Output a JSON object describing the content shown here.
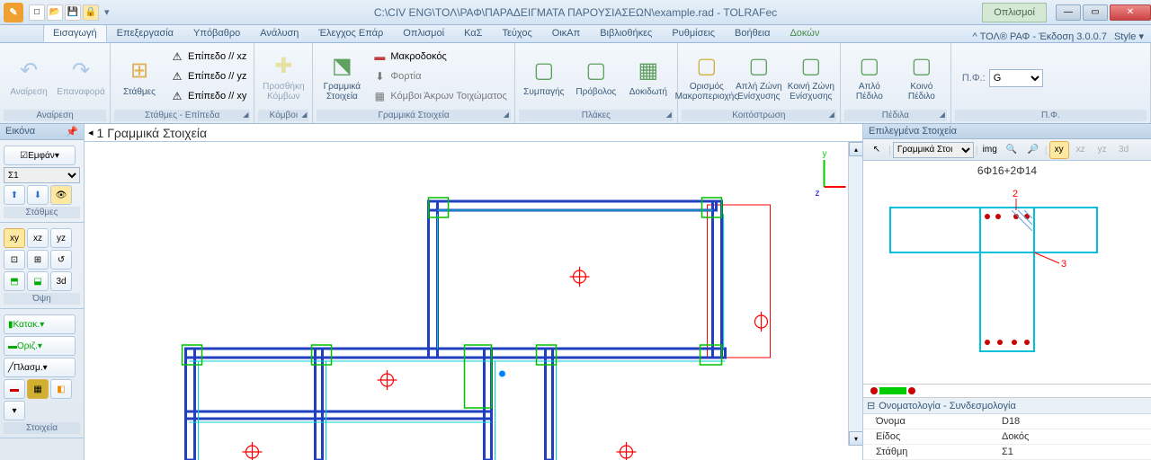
{
  "title": "C:\\CIV ENG\\ΤΟΛ\\ΡΑΦ\\ΠΑΡΑΔΕΙΓΜΑΤΑ ΠΑΡΟΥΣΙΑΣΕΩΝ\\example.rad - TOLRAFec",
  "context_tab": "Οπλισμοί",
  "version": "ΤΟΛ® ΡΑΦ - Έκδοση 3.0.0.7",
  "style_label": "Style",
  "tabs": [
    "Εισαγωγή",
    "Επεξεργασία",
    "Υπόβαθρο",
    "Ανάλυση",
    "Έλεγχος Επάρ",
    "Οπλισμοί",
    "ΚαΣ",
    "Τεύχος",
    "ΟικΑπ",
    "Βιβλιοθήκες",
    "Ρυθμίσεις",
    "Βοήθεια",
    "Δοκών"
  ],
  "ribbon": {
    "g1_title": "Αναίρεση",
    "g1_undo": "Αναίρεση",
    "g1_redo": "Επαναφορά",
    "g2_title": "Στάθμες - Επίπεδα",
    "g2_stathmes": "Στάθμες",
    "g2_xz": "Επίπεδο // xz",
    "g2_yz": "Επίπεδο // yz",
    "g2_xy": "Επίπεδο // xy",
    "g3_title": "Κόμβοι",
    "g3_node": "Προσθήκη\nΚόμβων",
    "g4_title": "Γραμμικά Στοιχεία",
    "g4_linear": "Γραμμικά\nΣτοιχεία",
    "g4_macro": "Μακροδοκός",
    "g4_load": "Φορτία",
    "g4_wall": "Κόμβοι Άκρων Τοιχώματος",
    "g5_title": "Πλάκες",
    "g5_solid": "Συμπαγής",
    "g5_cant": "Πρόβολος",
    "g5_holl": "Δοκιδωτή",
    "g6_title": "Κοιτόστρωση",
    "g6_macro": "Ορισμός\nΜακροπεριοχής",
    "g6_simple": "Απλή Ζώνη\nΕνίσχυσης",
    "g6_common": "Κοινή Ζώνη\nΕνίσχυσης",
    "g7_title": "Πέδιλα",
    "g7_simple": "Απλό\nΠέδιλο",
    "g7_common": "Κοινό\nΠέδιλο",
    "g8_title": "Π.Φ.",
    "g8_label": "Π.Φ.:",
    "g8_value": "G"
  },
  "left": {
    "image_title": "Εικόνα",
    "emfan": "Εμφάν",
    "sigma": "Σ1",
    "stathmes": "Στάθμες",
    "opsi": "Όψη",
    "stoixeia": "Στοιχεία",
    "katak": "Κατακ.",
    "oriz": "Οριζ.",
    "plasm": "Πλασμ.",
    "xy": "xy",
    "xz": "xz",
    "yz": "yz",
    "d3": "3d"
  },
  "doc": {
    "title": "1 Γραμμικά Στοιχεία"
  },
  "right": {
    "title": "Επιλεγμένα Στοιχεία",
    "combo": "Γραμμικά Στοι",
    "img": "img",
    "xy": "xy",
    "xz": "xz",
    "yz": "yz",
    "d3": "3d",
    "rebar": "6Φ16+2Φ14",
    "m2": "2",
    "m3": "3",
    "cat1": "Ονοματολογία - Συνδεσμολογία",
    "p1": "Όνομα",
    "v1": "D18",
    "p2": "Είδος",
    "v2": "Δοκός",
    "p3": "Στάθμη",
    "v3": "Σ1"
  }
}
